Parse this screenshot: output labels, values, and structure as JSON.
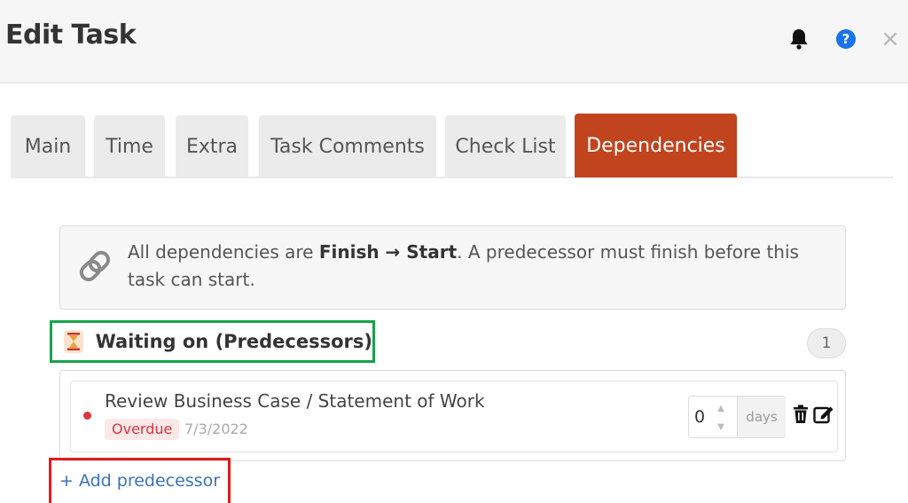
{
  "header": {
    "title": "Edit Task",
    "close_label": "×"
  },
  "tabs": [
    {
      "label": "Main",
      "active": false
    },
    {
      "label": "Time",
      "active": false
    },
    {
      "label": "Extra",
      "active": false
    },
    {
      "label": "Task Comments",
      "active": false
    },
    {
      "label": "Check List",
      "active": false
    },
    {
      "label": "Dependencies",
      "active": true
    }
  ],
  "info": {
    "text_before": "All dependencies are ",
    "bold": "Finish → Start",
    "text_after": ". A predecessor must finish before this task can start."
  },
  "predecessors": {
    "title": "Waiting on (Predecessors)",
    "count": "1",
    "items": [
      {
        "name": "Review Business Case / Statement of Work",
        "status": "Overdue",
        "date": "7/3/2022",
        "lag_value": "0",
        "lag_unit": "days"
      }
    ],
    "add_label": "+ Add predecessor"
  },
  "colors": {
    "accent": "#c2441f",
    "overdue": "#d9363e",
    "link": "#3b73b9"
  }
}
